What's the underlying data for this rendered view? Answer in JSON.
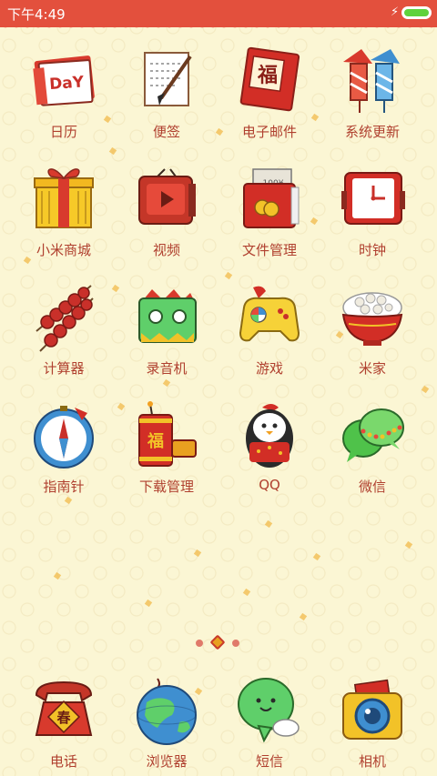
{
  "status_bar": {
    "time": "下午4:49",
    "battery_level": 1.0,
    "charging": true
  },
  "colors": {
    "status_bar": "#e3503d",
    "background": "#fbf6d4",
    "label": "#b0402f",
    "battery_fill": "#5ed23c"
  },
  "apps": [
    {
      "label": "日历",
      "icon": "calendar-icon"
    },
    {
      "label": "便签",
      "icon": "notes-icon"
    },
    {
      "label": "电子邮件",
      "icon": "email-icon"
    },
    {
      "label": "系统更新",
      "icon": "firecracker-update-icon"
    },
    {
      "label": "小米商城",
      "icon": "gift-box-icon"
    },
    {
      "label": "视频",
      "icon": "video-tv-icon"
    },
    {
      "label": "文件管理",
      "icon": "red-envelope-folder-icon"
    },
    {
      "label": "时钟",
      "icon": "clock-icon"
    },
    {
      "label": "计算器",
      "icon": "candied-haws-icon"
    },
    {
      "label": "录音机",
      "icon": "recorder-icon"
    },
    {
      "label": "游戏",
      "icon": "gamepad-icon"
    },
    {
      "label": "米家",
      "icon": "rice-bowl-icon"
    },
    {
      "label": "指南针",
      "icon": "compass-icon"
    },
    {
      "label": "下载管理",
      "icon": "firecracker-download-icon"
    },
    {
      "label": "QQ",
      "icon": "qq-penguin-icon"
    },
    {
      "label": "微信",
      "icon": "wechat-icon"
    }
  ],
  "page_indicator": {
    "pages": 3,
    "current": 2
  },
  "dock": [
    {
      "label": "电话",
      "icon": "phone-icon"
    },
    {
      "label": "浏览器",
      "icon": "browser-globe-icon"
    },
    {
      "label": "短信",
      "icon": "message-bubble-icon"
    },
    {
      "label": "相机",
      "icon": "camera-icon"
    }
  ],
  "icon_text": {
    "calendar": "DaY",
    "email": "福",
    "download": "福",
    "phone": "春",
    "envelope": "100¥"
  }
}
